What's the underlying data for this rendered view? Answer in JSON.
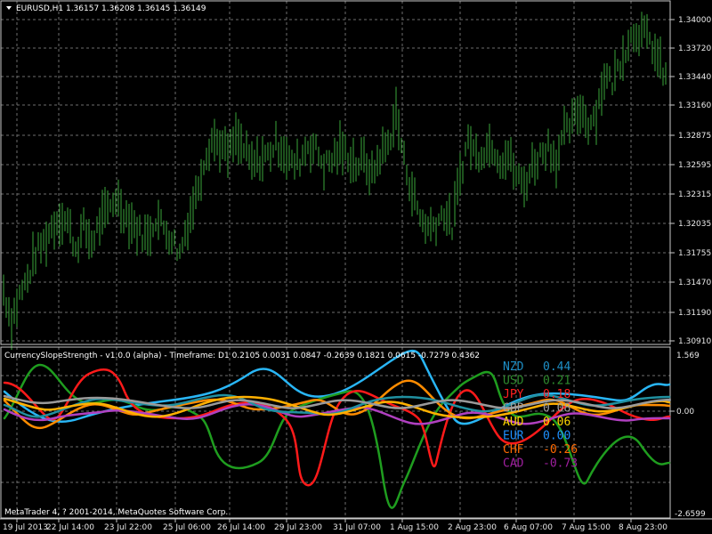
{
  "main_chart": {
    "symbol_header": "EURUSD,H1  1.36157 1.36208 1.36145 1.36149",
    "price_ticks": [
      "1.34000",
      "1.33720",
      "1.33440",
      "1.33160",
      "1.32875",
      "1.32595",
      "1.32315",
      "1.32035",
      "1.31755",
      "1.31470",
      "1.31190",
      "1.30910"
    ],
    "price_min": 1.3091,
    "price_max": 1.34,
    "candle_color": "#3aa63a",
    "close_path": [
      1.314,
      1.311,
      1.3135,
      1.315,
      1.3175,
      1.3185,
      1.32,
      1.321,
      1.3205,
      1.318,
      1.32,
      1.3185,
      1.3205,
      1.3215,
      1.323,
      1.3215,
      1.3205,
      1.3195,
      1.319,
      1.321,
      1.32,
      1.319,
      1.3175,
      1.3205,
      1.323,
      1.3265,
      1.3285,
      1.328,
      1.327,
      1.3285,
      1.3275,
      1.326,
      1.3265,
      1.327,
      1.328,
      1.3275,
      1.326,
      1.3265,
      1.328,
      1.3275,
      1.326,
      1.3265,
      1.3275,
      1.327,
      1.326,
      1.3265,
      1.325,
      1.327,
      1.328,
      1.331,
      1.3265,
      1.3235,
      1.321,
      1.32,
      1.3205,
      1.3215,
      1.32,
      1.325,
      1.3285,
      1.327,
      1.3275,
      1.328,
      1.3265,
      1.327,
      1.325,
      1.324,
      1.326,
      1.327,
      1.328,
      1.3265,
      1.329,
      1.33,
      1.3315,
      1.33,
      1.331,
      1.3345,
      1.334,
      1.336,
      1.338,
      1.339,
      1.3385,
      1.3375,
      1.3355,
      1.334
    ]
  },
  "indicator": {
    "header": "CurrencySlopeStrength - v1.0.0 (alpha) - Timeframe: D1 0.2105 0.0031 0.0847 -0.2639 0.1821 0.0615 -0.7279 0.4362",
    "top_tick": "1.569",
    "mid_tick": "0.00",
    "bottom_tick": "-2.6599",
    "legend": [
      {
        "currency": "NZD",
        "value": "0.44",
        "color": "#1e90c8"
      },
      {
        "currency": "USD",
        "value": "0.21",
        "color": "#2e8b2e"
      },
      {
        "currency": "JPY",
        "value": "0.18",
        "color": "#ff2020"
      },
      {
        "currency": "GBP",
        "value": "0.08",
        "color": "#a0a0a0"
      },
      {
        "currency": "AUD",
        "value": "0.06",
        "color": "#ffd700"
      },
      {
        "currency": "EUR",
        "value": "0.00",
        "color": "#1e90ff"
      },
      {
        "currency": "CHF",
        "value": "-0.26",
        "color": "#ff6a00"
      },
      {
        "currency": "CAD",
        "value": "-0.73",
        "color": "#a020a0"
      }
    ],
    "series_colors": {
      "skyblue": "#29b6f6",
      "green": "#1f9d1f",
      "red": "#ff1a1a",
      "orange": "#ff8c00",
      "purple": "#b040c0",
      "teal": "#2090a0",
      "gold": "#ffb000",
      "grey": "#9a9a9a"
    },
    "copyright": "MetaTrader 4, ? 2001-2014, MetaQuotes Software Corp."
  },
  "time_axis": [
    "19 Jul 2013",
    "22 Jul 14:00",
    "23 Jul 22:00",
    "25 Jul 06:00",
    "26 Jul 14:00",
    "29 Jul 23:00",
    "31 Jul 07:00",
    "1 Aug 15:00",
    "2 Aug 23:00",
    "6 Aug 07:00",
    "7 Aug 15:00",
    "8 Aug 23:00"
  ],
  "header_icon": "dropdown-arrow-icon"
}
